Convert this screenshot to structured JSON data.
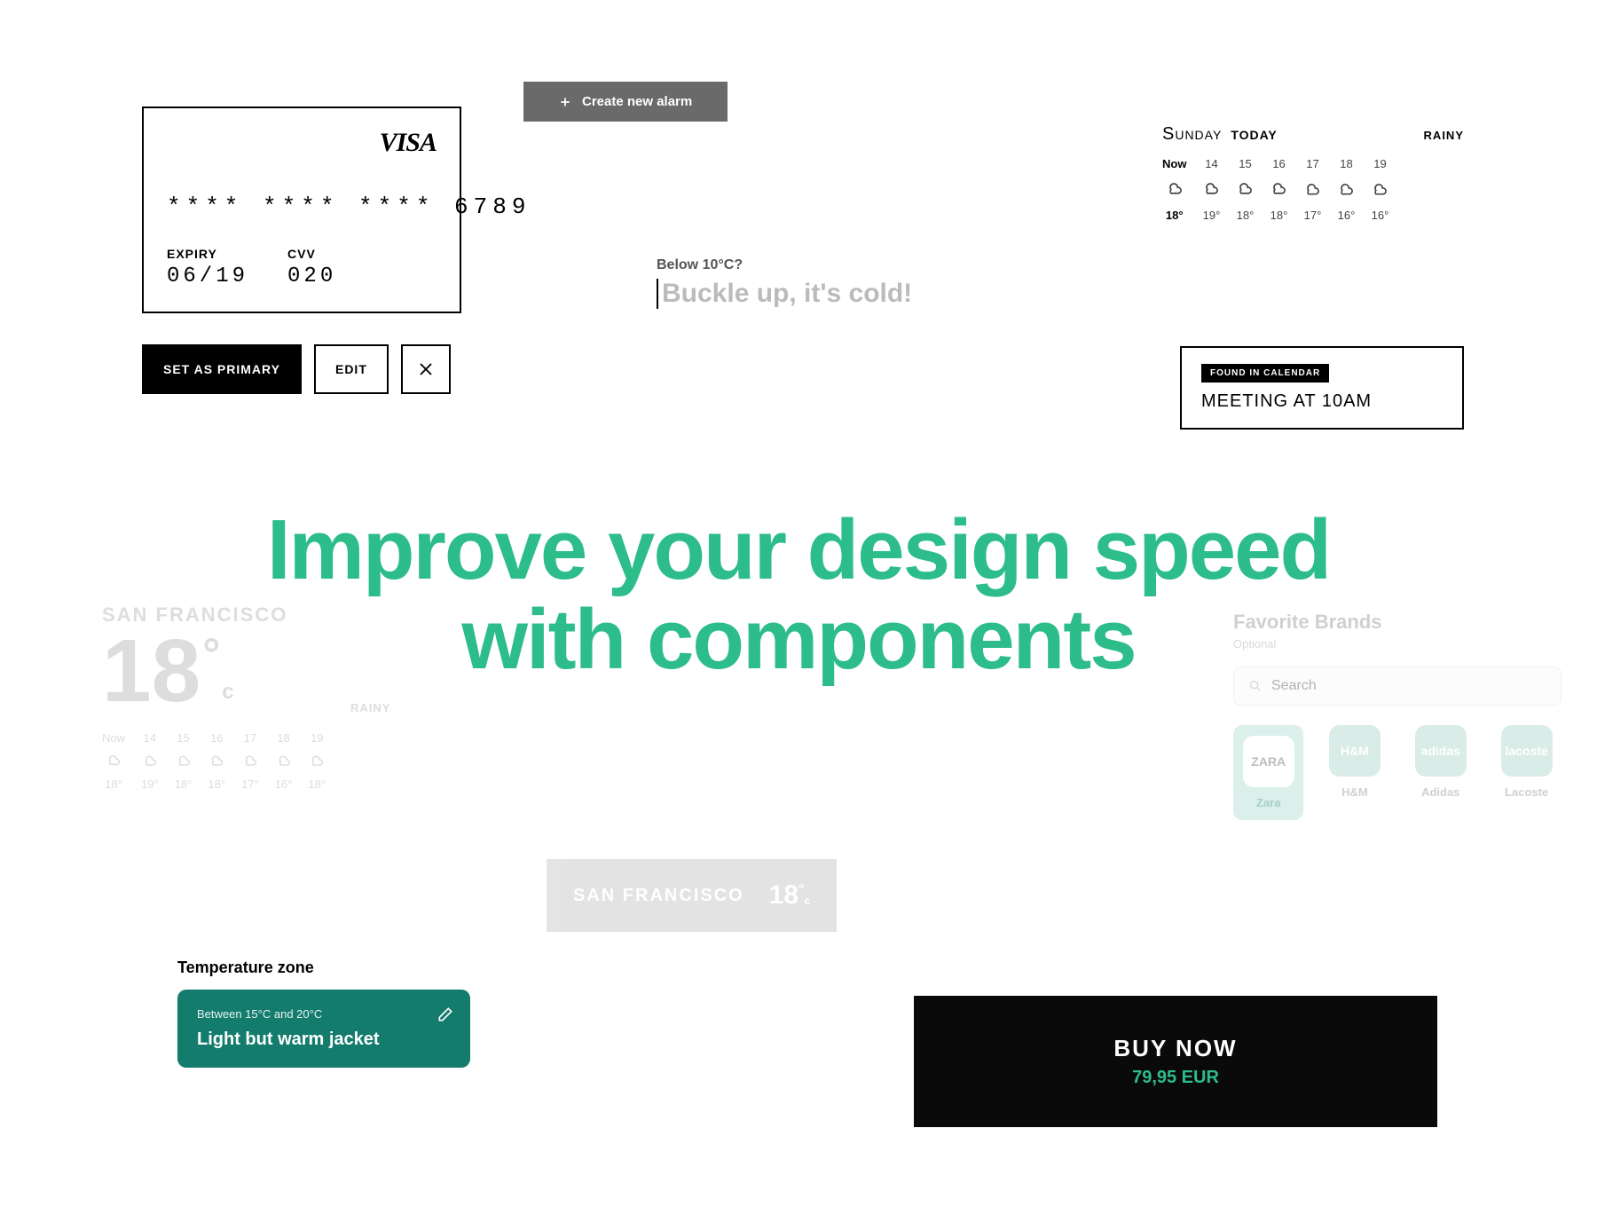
{
  "creditCard": {
    "brand": "VISA",
    "number": "**** **** **** 6789",
    "expiryLabel": "EXPIRY",
    "expiry": "06/19",
    "cvvLabel": "CVV",
    "cvv": "020",
    "actions": {
      "primary": "SET AS PRIMARY",
      "edit": "EDIT"
    }
  },
  "alarmChip": {
    "label": "Create new alarm"
  },
  "below10": {
    "question": "Below 10°C?",
    "placeholder": "Buckle up, it's cold!"
  },
  "weatherStrip": {
    "day": "Sunday",
    "todayLabel": "TODAY",
    "condition": "RAINY",
    "hours": [
      {
        "t": "Now",
        "temp": "18°",
        "icon": "rain",
        "now": true
      },
      {
        "t": "14",
        "temp": "19°",
        "icon": "rain"
      },
      {
        "t": "15",
        "temp": "18°",
        "icon": "rain"
      },
      {
        "t": "16",
        "temp": "18°",
        "icon": "rain"
      },
      {
        "t": "17",
        "temp": "17°",
        "icon": "cloud"
      },
      {
        "t": "18",
        "temp": "16°",
        "icon": "cloud"
      },
      {
        "t": "19",
        "temp": "16°",
        "icon": "cloud"
      }
    ]
  },
  "calendar": {
    "tag": "FOUND IN CALENDAR",
    "event": "MEETING AT 10AM"
  },
  "headline": {
    "line1": "Improve your design speed",
    "line2": "with components"
  },
  "weatherFaded": {
    "city": "SAN FRANCISCO",
    "temp": "18",
    "unit": "c",
    "condition": "RAINY",
    "hours": [
      {
        "t": "Now",
        "temp": "18°",
        "icon": "rain"
      },
      {
        "t": "14",
        "temp": "19°",
        "icon": "cloud"
      },
      {
        "t": "15",
        "temp": "18°",
        "icon": "cloud"
      },
      {
        "t": "16",
        "temp": "18°",
        "icon": "cloud"
      },
      {
        "t": "17",
        "temp": "17°",
        "icon": "cloud"
      },
      {
        "t": "18",
        "temp": "16°",
        "icon": "cloud"
      },
      {
        "t": "19",
        "temp": "18°",
        "icon": "cloud"
      }
    ]
  },
  "brands": {
    "title": "Favorite Brands",
    "optional": "Optional",
    "searchPlaceholder": "Search",
    "items": [
      {
        "name": "Zara",
        "abbr": "ZARA",
        "selected": true
      },
      {
        "name": "H&M",
        "abbr": "H&M"
      },
      {
        "name": "Adidas",
        "abbr": "adidas"
      },
      {
        "name": "Lacoste",
        "abbr": "lacoste"
      }
    ]
  },
  "sfPill": {
    "city": "SAN FRANCISCO",
    "temp": "18",
    "unit": "c"
  },
  "tempZone": {
    "title": "Temperature zone",
    "range": "Between 15°C and 20°C",
    "rec": "Light but warm jacket"
  },
  "buy": {
    "cta": "BUY NOW",
    "price": "79,95 EUR"
  }
}
